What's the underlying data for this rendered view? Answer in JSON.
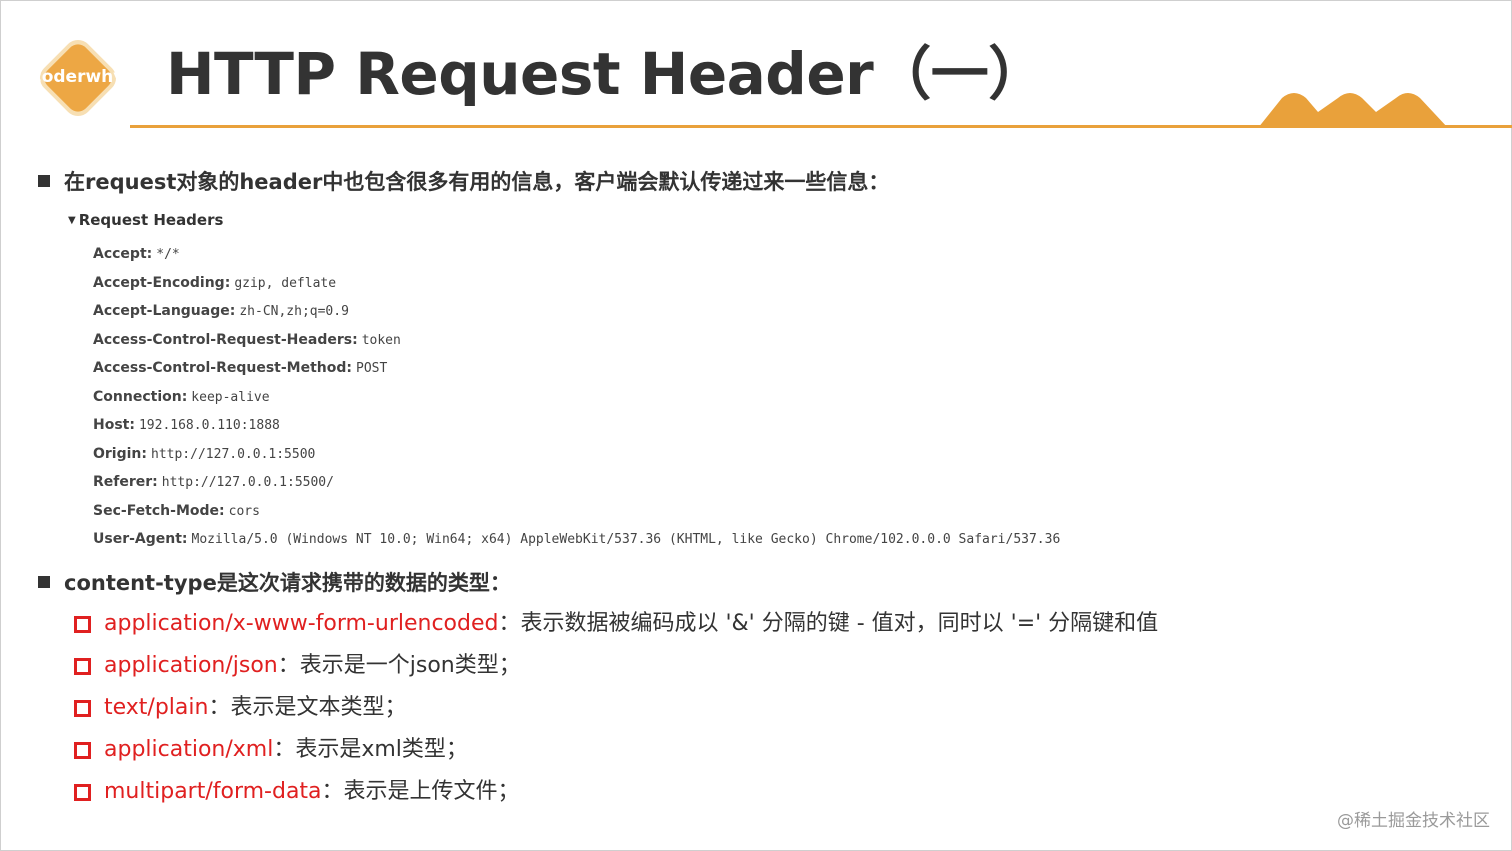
{
  "header": {
    "logo_text": "coderwhy",
    "title": "HTTP Request Header（一）"
  },
  "colors": {
    "accent": "#e9a13b",
    "text": "#333333",
    "red": "#e02020"
  },
  "intro": {
    "text": "在request对象的header中也包含很多有用的信息，客户端会默认传递过来一些信息："
  },
  "request_headers": {
    "title": "Request Headers",
    "items": [
      {
        "name": "Accept:",
        "value": "*/*"
      },
      {
        "name": "Accept-Encoding:",
        "value": "gzip, deflate"
      },
      {
        "name": "Accept-Language:",
        "value": "zh-CN,zh;q=0.9"
      },
      {
        "name": "Access-Control-Request-Headers:",
        "value": "token"
      },
      {
        "name": "Access-Control-Request-Method:",
        "value": "POST"
      },
      {
        "name": "Connection:",
        "value": "keep-alive"
      },
      {
        "name": "Host:",
        "value": "192.168.0.110:1888"
      },
      {
        "name": "Origin:",
        "value": "http://127.0.0.1:5500"
      },
      {
        "name": "Referer:",
        "value": "http://127.0.0.1:5500/"
      },
      {
        "name": "Sec-Fetch-Mode:",
        "value": "cors"
      },
      {
        "name": "User-Agent:",
        "value": "Mozilla/5.0 (Windows NT 10.0; Win64; x64) AppleWebKit/537.36 (KHTML, like Gecko) Chrome/102.0.0.0 Safari/537.36"
      }
    ]
  },
  "content_type": {
    "heading": "content-type是这次请求携带的数据的类型：",
    "items": [
      {
        "name": "application/x-www-form-urlencoded",
        "desc": "：表示数据被编码成以 '&' 分隔的键 - 值对，同时以 '=' 分隔键和值"
      },
      {
        "name": "application/json",
        "desc": "：表示是一个json类型；"
      },
      {
        "name": "text/plain",
        "desc": "：表示是文本类型；"
      },
      {
        "name": "application/xml",
        "desc": "：表示是xml类型；"
      },
      {
        "name": "multipart/form-data",
        "desc": "：表示是上传文件；"
      }
    ]
  },
  "watermark": "@稀土掘金技术社区"
}
